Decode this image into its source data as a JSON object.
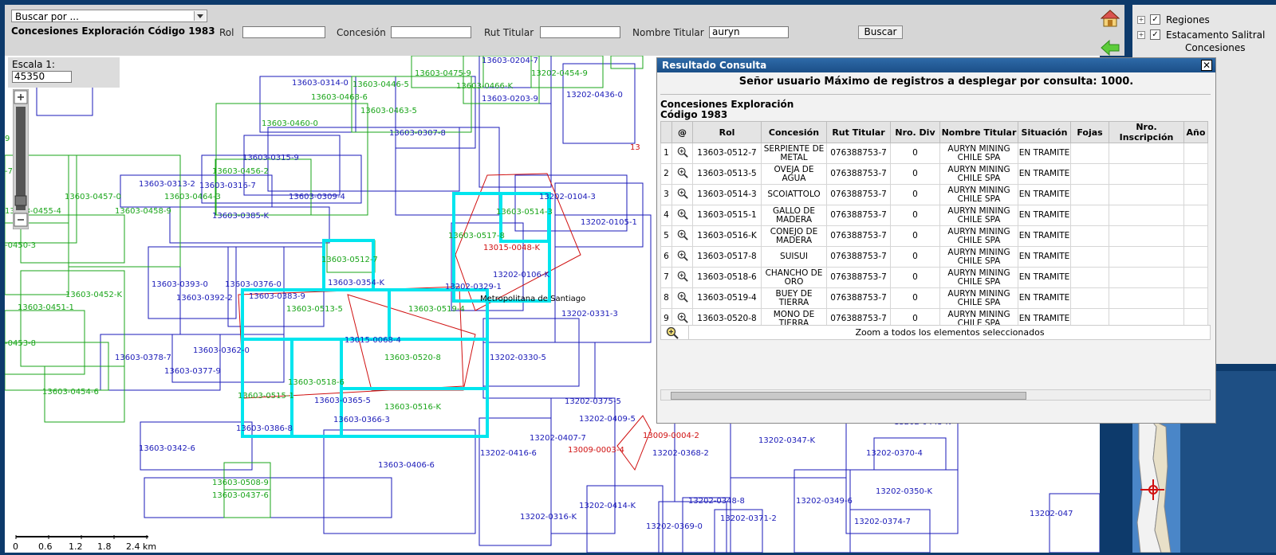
{
  "toolbar": {
    "search_select": "Buscar por ...",
    "title": "Concesiones Exploración Código 1983",
    "rol_label": "Rol",
    "concesion_label": "Concesión",
    "rut_label": "Rut Titular",
    "nombre_label": "Nombre Titular",
    "nombre_value": "auryn",
    "buscar_label": "Buscar"
  },
  "scale": {
    "title": "Escala 1:",
    "value": "45350"
  },
  "scalebar": {
    "ticks": [
      "0",
      "0.6",
      "1.2",
      "1.8",
      "2.4 km"
    ]
  },
  "layers": {
    "items": [
      "Regiones",
      "Estacamento Salitral",
      "Concesiones"
    ]
  },
  "map": {
    "region_label": "Metropolitana de Santiago",
    "colors": {
      "blue": "#1a1ab8",
      "green": "#1aa51a",
      "red": "#d01010",
      "cyan": "#00e5ee"
    }
  },
  "dialog": {
    "title": "Resultado Consulta",
    "message": "Señor usuario Máximo de registros a desplegar por consulta: 1000.",
    "subtitle_line1": "Concesiones Exploración",
    "subtitle_line2": "Código 1983",
    "columns": [
      "@",
      "Rol",
      "Concesión",
      "Rut Titular",
      "Nro. Div",
      "Nombre Titular",
      "Situación",
      "Fojas",
      "Nro. Inscripción",
      "Año"
    ],
    "rows": [
      {
        "n": "1",
        "rol": "13603-0512-7",
        "concesion": "SERPIENTE DE METAL",
        "rut": "076388753-7",
        "div": "0",
        "titular": "AURYN MINING CHILE SPA",
        "situacion": "EN TRAMITE"
      },
      {
        "n": "2",
        "rol": "13603-0513-5",
        "concesion": "OVEJA DE AGUA",
        "rut": "076388753-7",
        "div": "0",
        "titular": "AURYN MINING CHILE SPA",
        "situacion": "EN TRAMITE"
      },
      {
        "n": "3",
        "rol": "13603-0514-3",
        "concesion": "SCOIATTOLO",
        "rut": "076388753-7",
        "div": "0",
        "titular": "AURYN MINING CHILE SPA",
        "situacion": "EN TRAMITE"
      },
      {
        "n": "4",
        "rol": "13603-0515-1",
        "concesion": "GALLO DE MADERA",
        "rut": "076388753-7",
        "div": "0",
        "titular": "AURYN MINING CHILE SPA",
        "situacion": "EN TRAMITE"
      },
      {
        "n": "5",
        "rol": "13603-0516-K",
        "concesion": "CONEJO DE MADERA",
        "rut": "076388753-7",
        "div": "0",
        "titular": "AURYN MINING CHILE SPA",
        "situacion": "EN TRAMITE"
      },
      {
        "n": "6",
        "rol": "13603-0517-8",
        "concesion": "SUISUI",
        "rut": "076388753-7",
        "div": "0",
        "titular": "AURYN MINING CHILE SPA",
        "situacion": "EN TRAMITE"
      },
      {
        "n": "7",
        "rol": "13603-0518-6",
        "concesion": "CHANCHO DE ORO",
        "rut": "076388753-7",
        "div": "0",
        "titular": "AURYN MINING CHILE SPA",
        "situacion": "EN TRAMITE"
      },
      {
        "n": "8",
        "rol": "13603-0519-4",
        "concesion": "BUEY DE TIERRA",
        "rut": "076388753-7",
        "div": "0",
        "titular": "AURYN MINING CHILE SPA",
        "situacion": "EN TRAMITE"
      },
      {
        "n": "9",
        "rol": "13603-0520-8",
        "concesion": "MONO DE TIERRA",
        "rut": "076388753-7",
        "div": "0",
        "titular": "AURYN MINING CHILE SPA",
        "situacion": "EN TRAMITE"
      }
    ],
    "zoom_all_label": "Zoom a todos los elementos seleccionados"
  }
}
